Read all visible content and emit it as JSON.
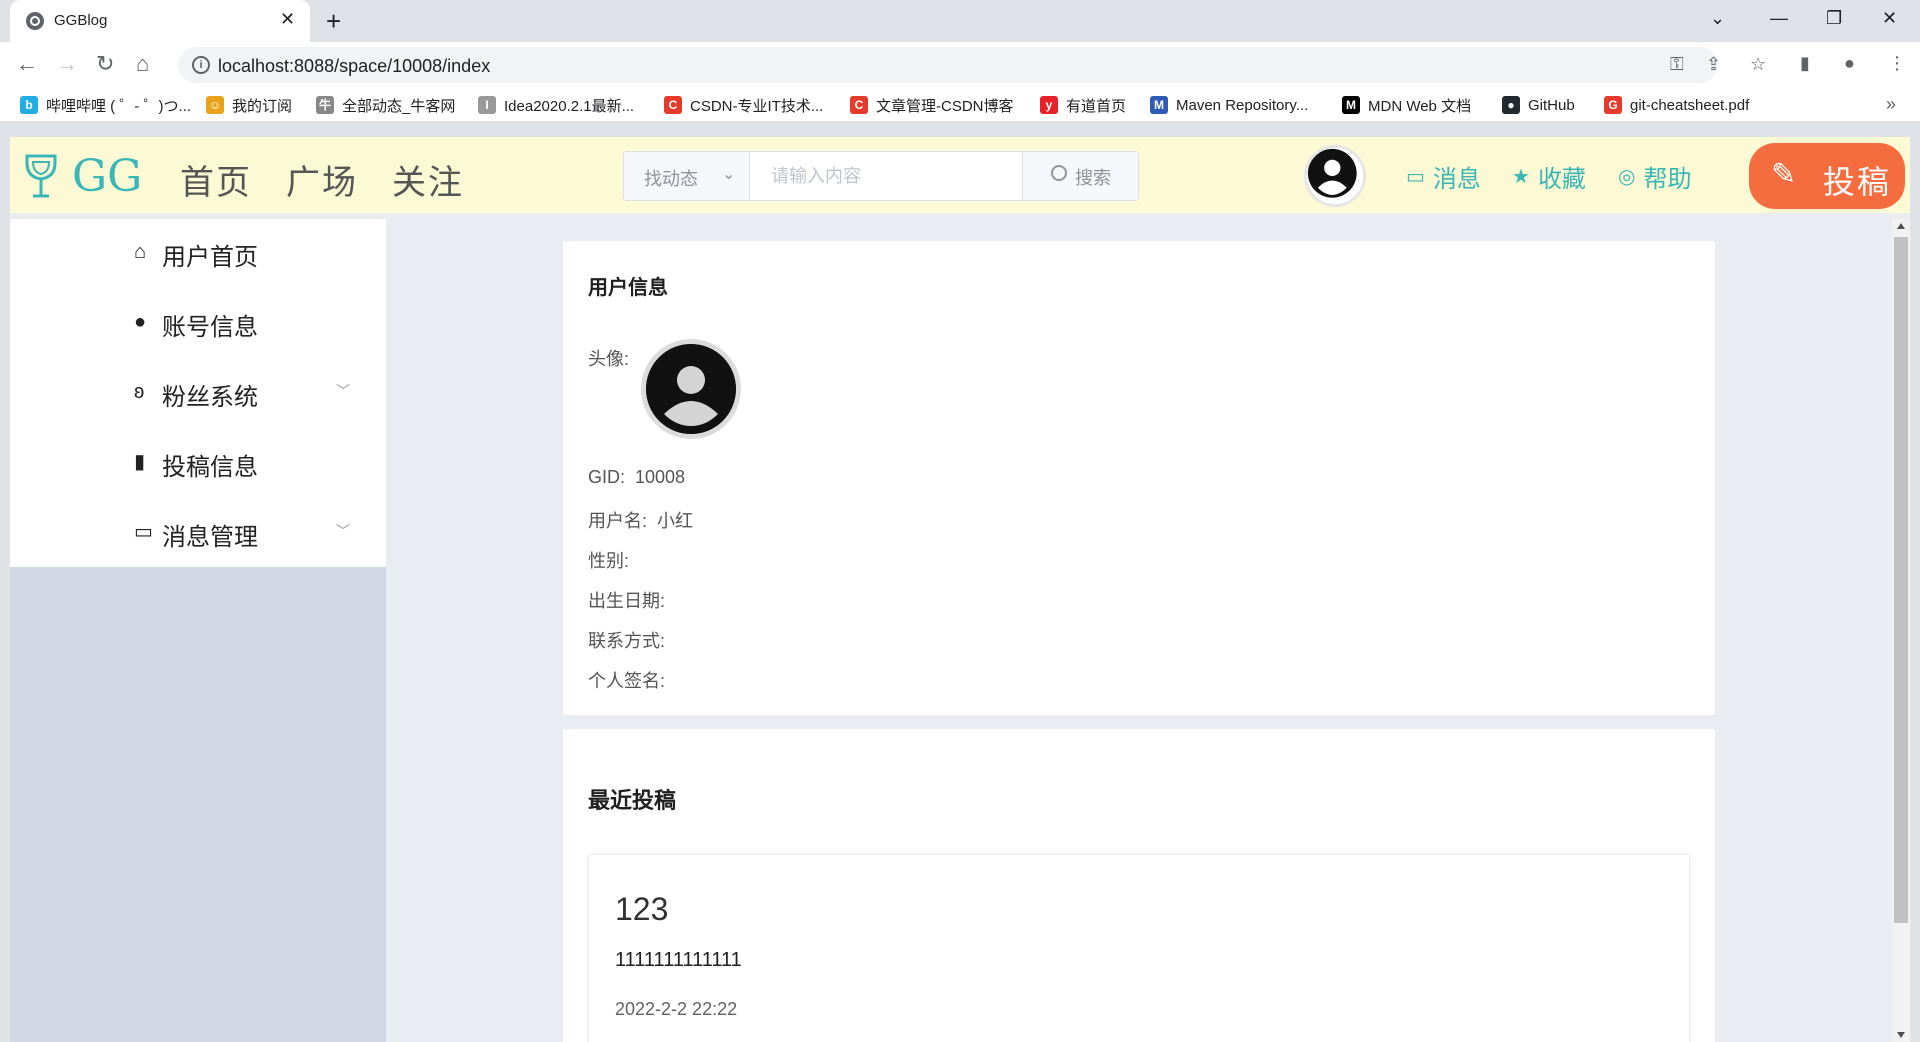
{
  "browser": {
    "tab_title": "GGBlog",
    "url": "localhost:8088/space/10008/index",
    "bookmarks": [
      {
        "label": "哔哩哔哩 ( ゜- ゜)つ...",
        "color": "#23ade5",
        "glyph": "b"
      },
      {
        "label": "我的订阅",
        "color": "#e8a31d",
        "glyph": "☺"
      },
      {
        "label": "全部动态_牛客网",
        "color": "#888888",
        "glyph": "牛"
      },
      {
        "label": "Idea2020.2.1最新...",
        "color": "#999999",
        "glyph": "I"
      },
      {
        "label": "CSDN-专业IT技术...",
        "color": "#e53a2c",
        "glyph": "C"
      },
      {
        "label": "文章管理-CSDN博客",
        "color": "#e53a2c",
        "glyph": "C"
      },
      {
        "label": "有道首页",
        "color": "#e8202a",
        "glyph": "y"
      },
      {
        "label": "Maven Repository...",
        "color": "#2f5bb7",
        "glyph": "M"
      },
      {
        "label": "MDN Web 文档",
        "color": "#000000",
        "glyph": "M"
      },
      {
        "label": "GitHub",
        "color": "#24292e",
        "glyph": "●"
      },
      {
        "label": "git-cheatsheet.pdf",
        "color": "#e53a2c",
        "glyph": "G"
      }
    ]
  },
  "header": {
    "logo_text": "GG",
    "nav": [
      "首页",
      "广场",
      "关注"
    ],
    "search_type": "找动态",
    "search_placeholder": "请输入内容",
    "search_button": "搜索",
    "links": {
      "messages": "消息",
      "favorites": "收藏",
      "help": "帮助"
    },
    "submit_label": "投稿",
    "colors": {
      "accent": "#3bb6b6",
      "submit": "#f56c3f",
      "header_bg": "#fbfad4"
    }
  },
  "sidebar": {
    "items": [
      {
        "label": "用户首页",
        "icon": "home-icon",
        "has_submenu": false
      },
      {
        "label": "账号信息",
        "icon": "user-icon",
        "has_submenu": false
      },
      {
        "label": "粉丝系统",
        "icon": "fans-icon",
        "has_submenu": true
      },
      {
        "label": "投稿信息",
        "icon": "notebook-icon",
        "has_submenu": false
      },
      {
        "label": "消息管理",
        "icon": "chat-icon",
        "has_submenu": true
      }
    ]
  },
  "user_info": {
    "title": "用户信息",
    "avatar_label": "头像:",
    "gid_label": "GID:",
    "gid": "10008",
    "username_label": "用户名:",
    "username": "小红",
    "gender_label": "性别:",
    "gender": "",
    "birthday_label": "出生日期:",
    "birthday": "",
    "contact_label": "联系方式:",
    "contact": "",
    "signature_label": "个人签名:",
    "signature": ""
  },
  "recent_posts": {
    "title": "最近投稿",
    "posts": [
      {
        "title": "123",
        "body": "1111111111111",
        "date": "2022-2-2 22:22"
      }
    ]
  }
}
